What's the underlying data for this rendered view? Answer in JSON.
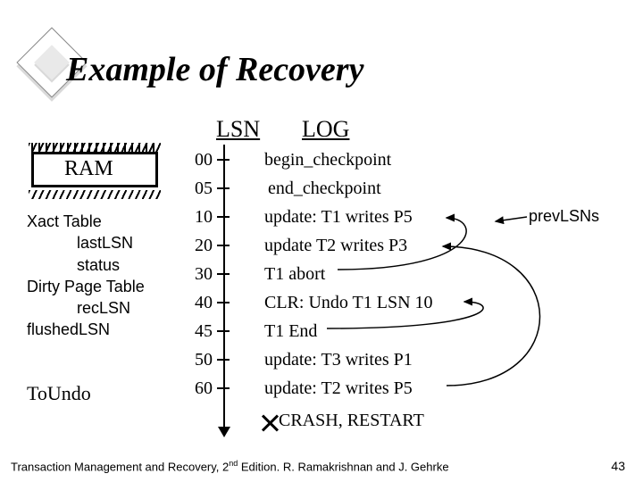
{
  "title": "Example of Recovery",
  "columns": {
    "lsn": "LSN",
    "log": "LOG"
  },
  "ram_label": "RAM",
  "left_panel": {
    "l1": "Xact Table",
    "l2": "lastLSN",
    "l3": "status",
    "l4": "Dirty Page Table",
    "l5": "recLSN",
    "l6": "flushedLSN"
  },
  "toundo": "ToUndo",
  "log": [
    {
      "lsn": "00",
      "text": "begin_checkpoint"
    },
    {
      "lsn": "05",
      "text": "end_checkpoint"
    },
    {
      "lsn": "10",
      "text": "update: T1 writes P5"
    },
    {
      "lsn": "20",
      "text": "update T2 writes P3"
    },
    {
      "lsn": "30",
      "text": "T1 abort"
    },
    {
      "lsn": "40",
      "text": "CLR: Undo T1 LSN 10"
    },
    {
      "lsn": "45",
      "text": "T1 End"
    },
    {
      "lsn": "50",
      "text": "update: T3 writes P1"
    },
    {
      "lsn": "60",
      "text": "update: T2 writes P5"
    }
  ],
  "crash_label": "CRASH, RESTART",
  "prevlsns_label": "prevLSNs",
  "footer": "Transaction Management and Recovery, 2",
  "footer_sup": "nd",
  "footer_tail": " Edition. R. Ramakrishnan and J. Gehrke",
  "page_number": "43"
}
